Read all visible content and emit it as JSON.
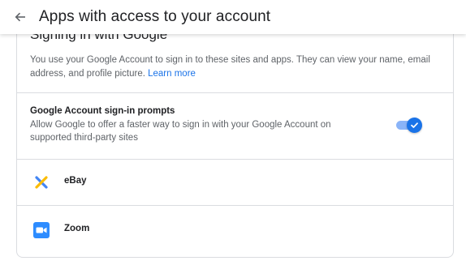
{
  "header": {
    "title": "Apps with access to your account"
  },
  "card": {
    "title": "Signing in with Google",
    "description": "You use your Google Account to sign in to these sites and apps. They can view your name, email address, and profile picture.",
    "learn_more": "Learn more"
  },
  "prompts": {
    "title": "Google Account sign-in prompts",
    "description": "Allow Google to offer a faster way to sign in with your Google Account on supported third-party sites",
    "enabled": true
  },
  "apps": [
    {
      "name": "eBay",
      "icon": "ebay-logo-icon"
    },
    {
      "name": "Zoom",
      "icon": "zoom-logo-icon"
    }
  ],
  "colors": {
    "accent": "#1a73e8",
    "toggle_track": "#8ab4f8",
    "divider": "#dadce0"
  }
}
